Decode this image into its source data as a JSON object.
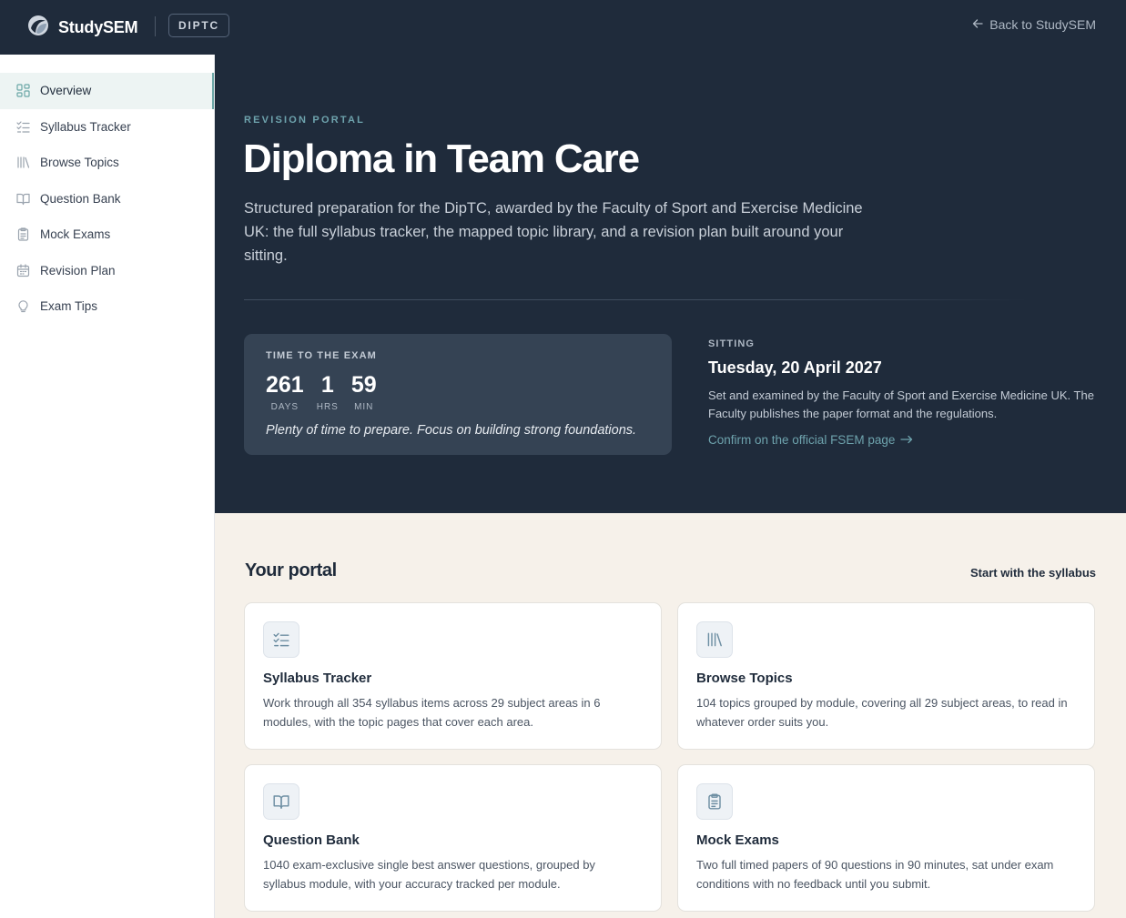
{
  "topbar": {
    "brand": "StudySEM",
    "badge": "DIPTC",
    "back_link": "Back to StudySEM"
  },
  "sidebar": {
    "items": [
      {
        "label": "Overview",
        "icon": "grid-icon",
        "active": true
      },
      {
        "label": "Syllabus Tracker",
        "icon": "checklist-icon",
        "active": false
      },
      {
        "label": "Browse Topics",
        "icon": "library-icon",
        "active": false
      },
      {
        "label": "Question Bank",
        "icon": "book-open-icon",
        "active": false
      },
      {
        "label": "Mock Exams",
        "icon": "clipboard-icon",
        "active": false
      },
      {
        "label": "Revision Plan",
        "icon": "calendar-icon",
        "active": false
      },
      {
        "label": "Exam Tips",
        "icon": "lightbulb-icon",
        "active": false
      }
    ]
  },
  "hero": {
    "eyebrow": "REVISION PORTAL",
    "title": "Diploma in Team Care",
    "description": "Structured preparation for the DipTC, awarded by the Faculty of Sport and Exercise Medicine UK: the full syllabus tracker, the mapped topic library, and a revision plan built around your sitting."
  },
  "countdown": {
    "label": "TIME TO THE EXAM",
    "days": "261",
    "days_label": "DAYS",
    "hours": "1",
    "hours_label": "HRS",
    "minutes": "59",
    "minutes_label": "MIN",
    "note": "Plenty of time to prepare. Focus on building strong foundations."
  },
  "sitting": {
    "label": "SITTING",
    "date": "Tuesday, 20 April 2027",
    "description": "Set and examined by the Faculty of Sport and Exercise Medicine UK. The Faculty publishes the paper format and the regulations.",
    "link": "Confirm on the official FSEM page"
  },
  "portal": {
    "title": "Your portal",
    "link": "Start with the syllabus",
    "cards": [
      {
        "title": "Syllabus Tracker",
        "description": "Work through all 354 syllabus items across 29 subject areas in 6 modules, with the topic pages that cover each area.",
        "icon": "checklist-icon"
      },
      {
        "title": "Browse Topics",
        "description": "104 topics grouped by module, covering all 29 subject areas, to read in whatever order suits you.",
        "icon": "library-icon"
      },
      {
        "title": "Question Bank",
        "description": "1040 exam-exclusive single best answer questions, grouped by syllabus module, with your accuracy tracked per module.",
        "icon": "book-open-icon"
      },
      {
        "title": "Mock Exams",
        "description": "Two full timed papers of 90 questions in 90 minutes, sat under exam conditions with no feedback until you submit.",
        "icon": "clipboard-icon"
      }
    ]
  },
  "colors": {
    "navy": "#1f2b3b",
    "accent_teal": "#6ea3ad",
    "cream": "#f6f1ea",
    "countdown_panel": "#354354"
  }
}
